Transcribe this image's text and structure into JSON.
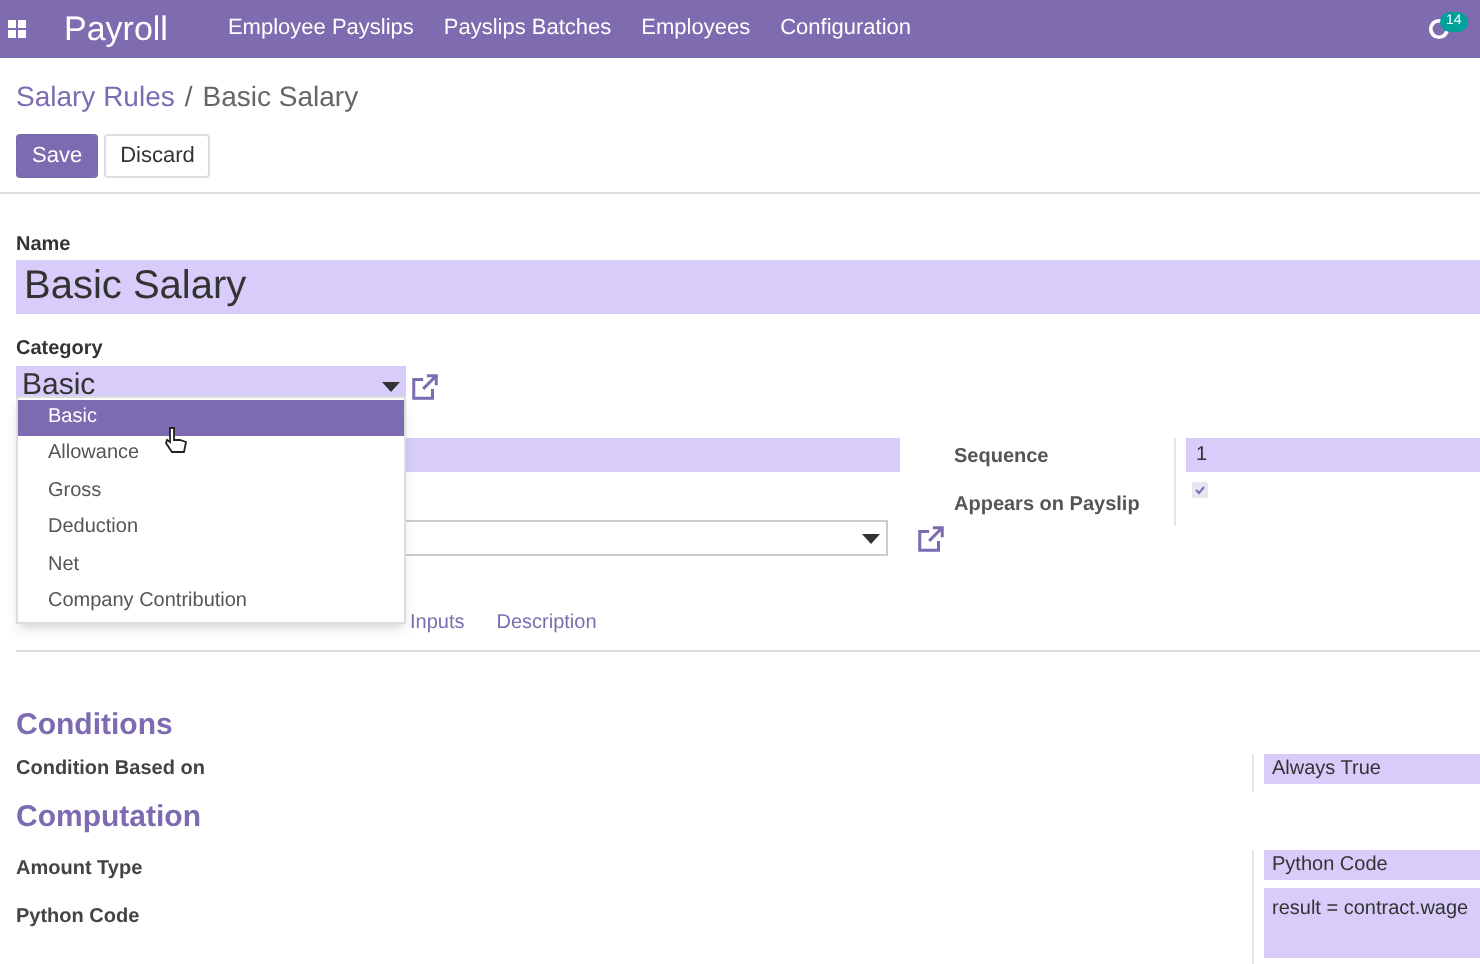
{
  "navbar": {
    "app_title": "Payroll",
    "menu": [
      "Employee Payslips",
      "Payslips Batches",
      "Employees",
      "Configuration"
    ],
    "badge": "14"
  },
  "breadcrumb": {
    "parent": "Salary Rules",
    "separator": "/",
    "current": "Basic Salary"
  },
  "buttons": {
    "save": "Save",
    "discard": "Discard"
  },
  "name": {
    "label": "Name",
    "value": "Basic Salary"
  },
  "category": {
    "label": "Category",
    "value": "Basic",
    "options": [
      {
        "label": "Basic",
        "selected": true
      },
      {
        "label": "Allowance",
        "selected": false
      },
      {
        "label": "Gross",
        "selected": false
      },
      {
        "label": "Deduction",
        "selected": false
      },
      {
        "label": "Net",
        "selected": false
      },
      {
        "label": "Company Contribution",
        "selected": false
      }
    ]
  },
  "sequence": {
    "label": "Sequence",
    "value": "1"
  },
  "appears_on_payslip": {
    "label": "Appears on Payslip",
    "checked": true
  },
  "tabs": [
    {
      "label": "Inputs",
      "selected": false
    },
    {
      "label": "Description",
      "selected": false
    }
  ],
  "conditions": {
    "title": "Conditions",
    "label": "Condition Based on",
    "value": "Always True"
  },
  "computation": {
    "title": "Computation",
    "amount_type_label": "Amount Type",
    "amount_type": "Python Code",
    "python_code_label": "Python Code",
    "python_code": "result = contract.wage"
  }
}
